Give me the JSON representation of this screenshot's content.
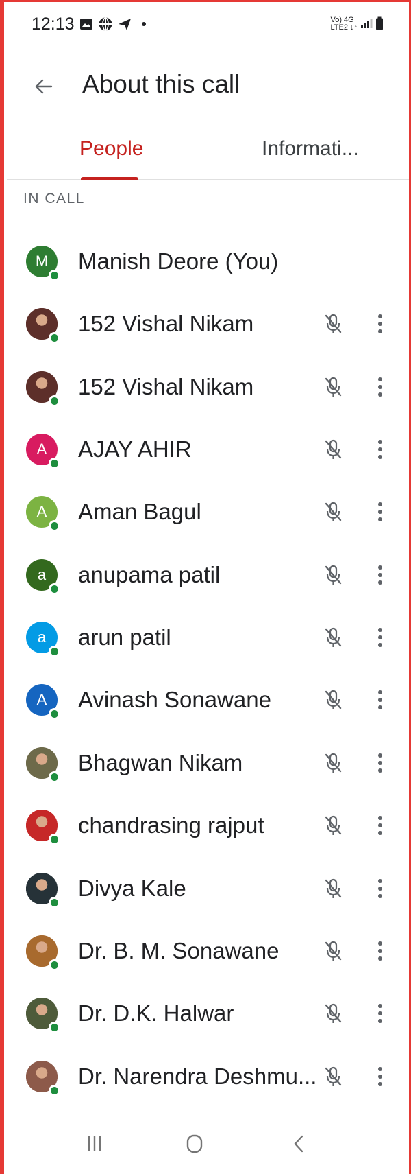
{
  "status_bar": {
    "time": "12:13",
    "left_icons": [
      "image-icon",
      "globe-icon",
      "send-icon",
      "dot-icon"
    ],
    "network_top": "Vo) 4G",
    "network_bottom": "LTE2 ↓↑"
  },
  "header": {
    "back_icon": "arrow-back-icon",
    "title": "About this call"
  },
  "tabs": [
    {
      "label": "People",
      "active": true
    },
    {
      "label": "Informati..."
    }
  ],
  "section_label": "IN CALL",
  "participants": [
    {
      "name": "Manish Deore (You)",
      "initial": "M",
      "color": "#2e7d32",
      "photo": false,
      "controls": false
    },
    {
      "name": "152 Vishal Nikam",
      "initial": "",
      "color": "#5d2f2a",
      "photo": true,
      "controls": true
    },
    {
      "name": "152 Vishal Nikam",
      "initial": "",
      "color": "#5d2f2a",
      "photo": true,
      "controls": true
    },
    {
      "name": "AJAY AHIR",
      "initial": "A",
      "color": "#d81b60",
      "photo": false,
      "controls": true
    },
    {
      "name": "Aman Bagul",
      "initial": "A",
      "color": "#7cb342",
      "photo": false,
      "controls": true
    },
    {
      "name": "anupama patil",
      "initial": "a",
      "color": "#33691e",
      "photo": false,
      "controls": true
    },
    {
      "name": "arun patil",
      "initial": "a",
      "color": "#039be5",
      "photo": false,
      "controls": true
    },
    {
      "name": "Avinash Sonawane",
      "initial": "A",
      "color": "#1565c0",
      "photo": false,
      "controls": true
    },
    {
      "name": "Bhagwan Nikam",
      "initial": "",
      "color": "#6d6a4a",
      "photo": true,
      "controls": true
    },
    {
      "name": "chandrasing rajput",
      "initial": "",
      "color": "#c62828",
      "photo": true,
      "controls": true
    },
    {
      "name": "Divya Kale",
      "initial": "",
      "color": "#263238",
      "photo": true,
      "controls": true
    },
    {
      "name": "Dr. B. M. Sonawane",
      "initial": "",
      "color": "#a86a2e",
      "photo": true,
      "controls": true
    },
    {
      "name": "Dr. D.K. Halwar",
      "initial": "",
      "color": "#4e5b3a",
      "photo": true,
      "controls": true
    },
    {
      "name": "Dr. Narendra Deshmu...",
      "initial": "",
      "color": "#8d5a4a",
      "photo": true,
      "controls": true
    }
  ],
  "nav_bar": [
    "recent-apps-icon",
    "home-icon",
    "back-nav-icon"
  ],
  "colors": {
    "accent": "#c5221f",
    "online": "#1e8e3e"
  }
}
